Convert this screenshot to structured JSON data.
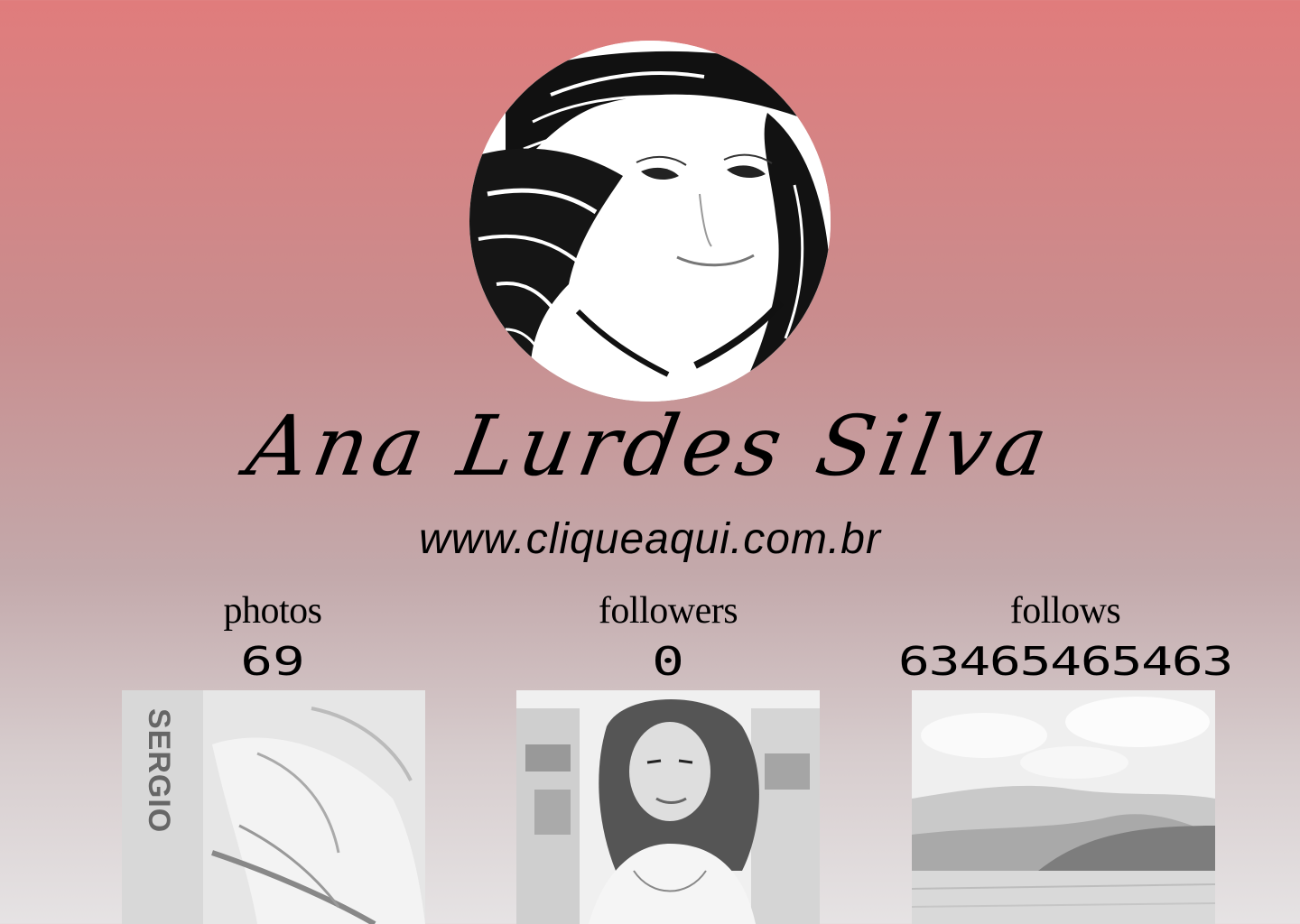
{
  "profile": {
    "name": "Ana Lurdes Silva",
    "website": "www.cliqueaqui.com.br",
    "avatar_icon": "profile-photo"
  },
  "stats": {
    "photos": {
      "label": "photos",
      "value": "69"
    },
    "followers": {
      "label": "followers",
      "value": "0"
    },
    "follows": {
      "label": "follows",
      "value": "63465465463"
    }
  },
  "thumbnails": {
    "poster_title": "SERGIO"
  },
  "colors": {
    "gradient_top": "#E07C7C",
    "gradient_mid": "#C3A9AB",
    "gradient_bottom": "#E6E3E4",
    "text": "#000000"
  }
}
